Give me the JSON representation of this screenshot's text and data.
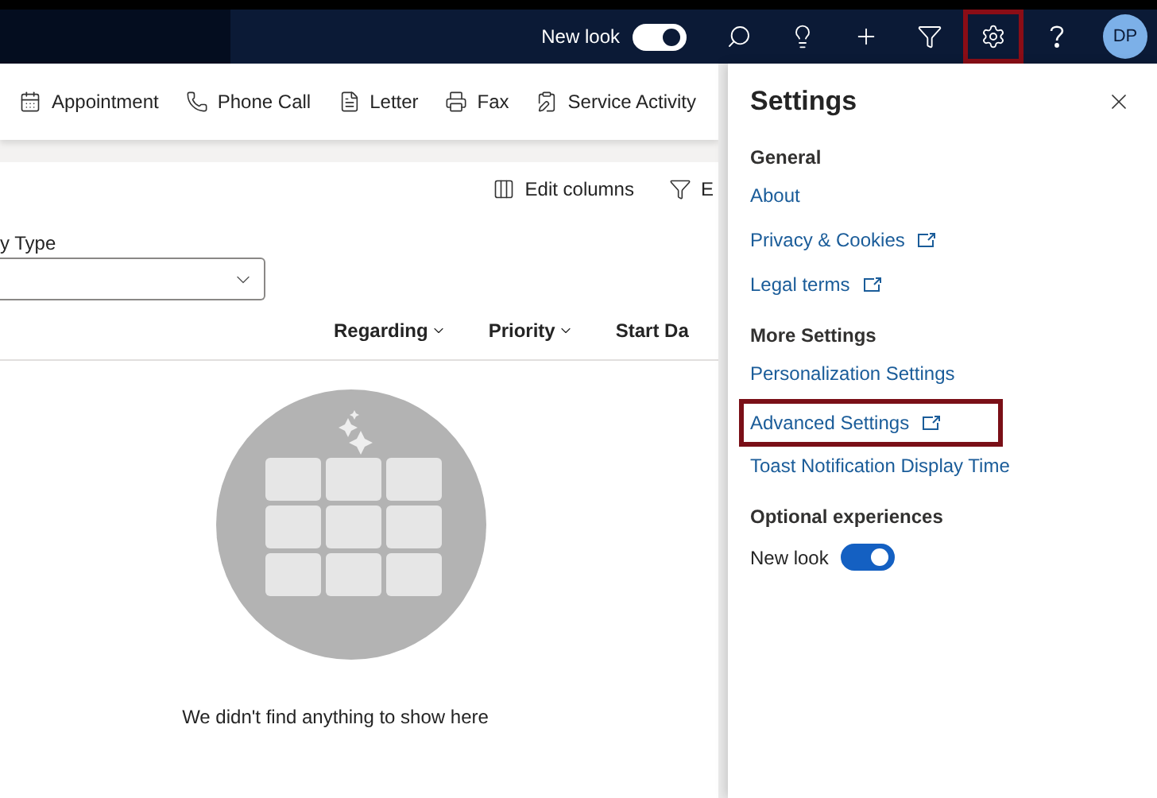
{
  "header": {
    "new_look": {
      "label": "New look",
      "on": true
    },
    "icons": [
      {
        "kind": "search",
        "highlighted": false
      },
      {
        "kind": "lightbulb",
        "highlighted": false
      },
      {
        "kind": "plus",
        "highlighted": false
      },
      {
        "kind": "filter",
        "highlighted": false
      },
      {
        "kind": "settings",
        "highlighted": true
      },
      {
        "kind": "help",
        "highlighted": false
      }
    ],
    "avatar": "DP"
  },
  "command_bar": [
    {
      "kind": "appointment",
      "label": "Appointment"
    },
    {
      "kind": "phone",
      "label": "Phone Call"
    },
    {
      "kind": "letter",
      "label": "Letter"
    },
    {
      "kind": "fax",
      "label": "Fax"
    },
    {
      "kind": "service",
      "label": "Service Activity"
    }
  ],
  "view_bar": [
    {
      "kind": "columns",
      "label": "Edit columns"
    },
    {
      "kind": "filter",
      "label": "E"
    }
  ],
  "filter": {
    "label": "y Type"
  },
  "columns": [
    {
      "label": "Regarding",
      "chevron": true
    },
    {
      "label": "Priority",
      "chevron": true
    },
    {
      "label": "Start Da",
      "chevron": false
    }
  ],
  "empty_state": {
    "message": "We didn't find anything to show here"
  },
  "settings": {
    "title": "Settings",
    "sections": [
      {
        "heading": "General",
        "links": [
          {
            "label": "About",
            "external": false,
            "highlighted": false
          },
          {
            "label": "Privacy & Cookies",
            "external": true,
            "highlighted": false
          },
          {
            "label": "Legal terms",
            "external": true,
            "highlighted": false
          }
        ]
      },
      {
        "heading": "More Settings",
        "links": [
          {
            "label": "Personalization Settings",
            "external": false,
            "highlighted": false
          },
          {
            "label": "Advanced Settings",
            "external": true,
            "highlighted": true
          },
          {
            "label": "Toast Notification Display Time",
            "external": false,
            "highlighted": false
          }
        ]
      }
    ],
    "optional": {
      "heading": "Optional experiences",
      "toggle": {
        "label": "New look",
        "on": true
      }
    }
  }
}
